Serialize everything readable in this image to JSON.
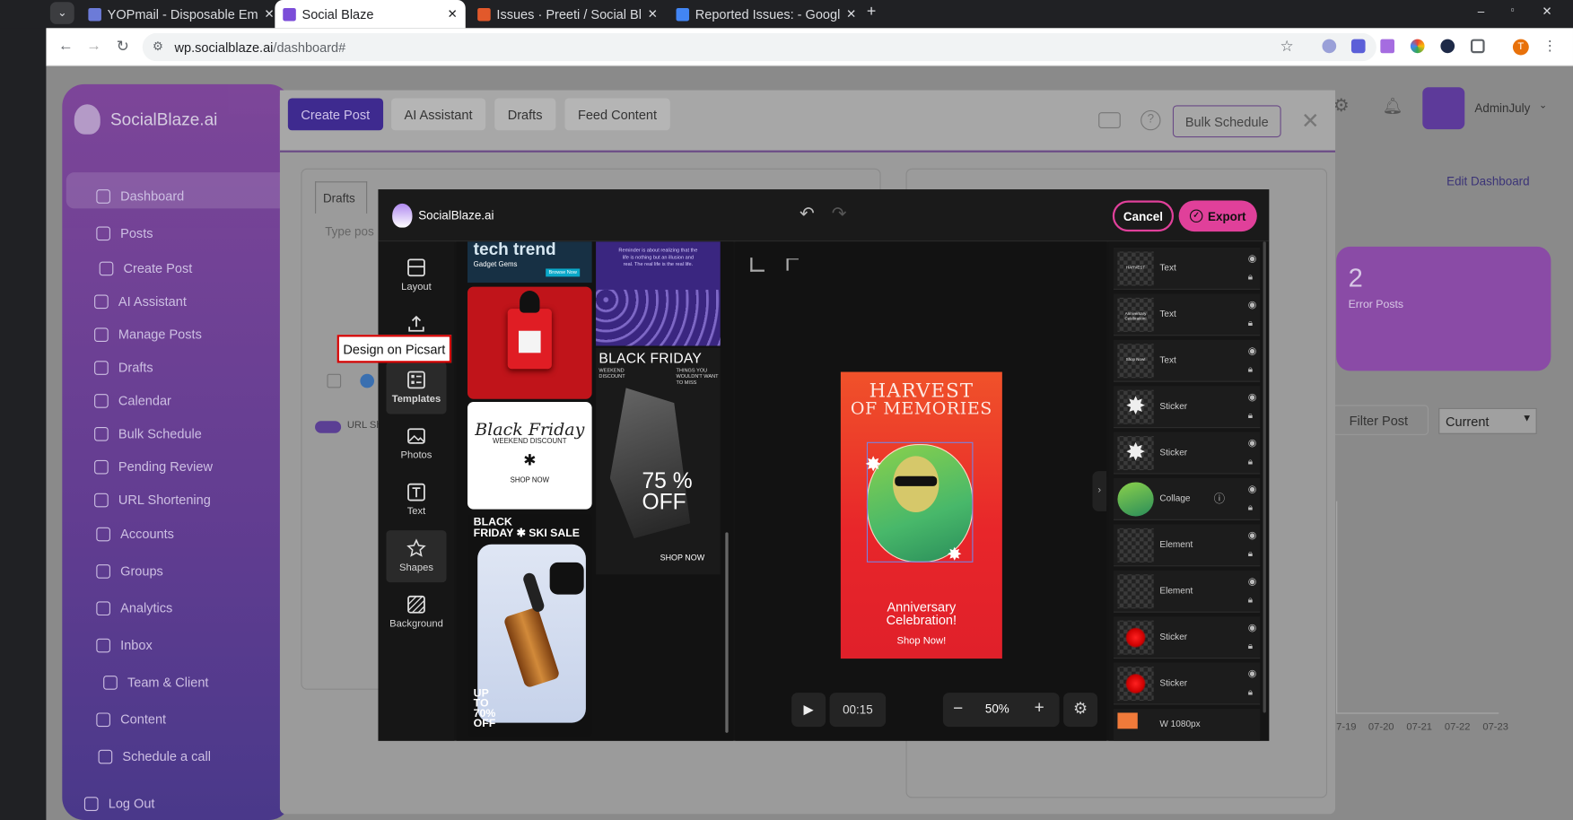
{
  "browser": {
    "tabs": [
      {
        "label": "YOPmail - Disposable Em",
        "color": "#6c7bd8"
      },
      {
        "label": "Social Blaze",
        "color": "#7b4dd8"
      },
      {
        "label": "Issues · Preeti / Social Bl",
        "color": "#e2592b"
      },
      {
        "label": "Reported Issues: - Googl",
        "color": "#4285f4"
      }
    ],
    "url_host": "wp.socialblaze.ai",
    "url_path": "/dashboard#",
    "profile_initial": "T"
  },
  "app": {
    "logo": "SocialBlaze.ai",
    "user": "AdminJuly",
    "sidebar": [
      "Dashboard",
      "Posts",
      "Create Post",
      "AI Assistant",
      "Manage Posts",
      "Drafts",
      "Calendar",
      "Bulk Schedule",
      "Pending Review",
      "URL Shortening",
      "Accounts",
      "Groups",
      "Analytics",
      "Inbox",
      "Team & Client",
      "Content",
      "Schedule a call",
      "Log Out"
    ],
    "edit_dashboard": "Edit Dashboard",
    "error_count": "2",
    "error_label": "Error Posts",
    "filter_post": "Filter Post",
    "filter_select": "Current",
    "dates": [
      "7-19",
      "07-20",
      "07-21",
      "07-22",
      "07-23"
    ]
  },
  "create_post": {
    "tabs": [
      "Create Post",
      "AI Assistant",
      "Drafts",
      "Feed Content"
    ],
    "bulk_schedule": "Bulk Schedule",
    "drafts_tab": "Drafts",
    "placeholder": "Type pos",
    "url_toggle": "URL Sh"
  },
  "editor": {
    "logo": "SocialBlaze.ai",
    "cancel": "Cancel",
    "export": "Export",
    "tools": [
      "Layout",
      "",
      "Templates",
      "Photos",
      "Text",
      "Shapes",
      "Background"
    ],
    "tooltip": "Design on Picsart",
    "templates": {
      "tech_title": "tech trend",
      "tech_sub": "Gadget Gems",
      "tech_btn": "Browse Now",
      "quote": "Reminder is about realizing that the life is nothing but an illusion and real. The real life is the real life.",
      "bf_script": "Black Friday",
      "bf_sub": "WEEKEND DISCOUNT",
      "bf_shop": "SHOP NOW",
      "bf2_title": "BLACK FRIDAY",
      "bf2_sub": "WEEKEND DISCOUNT",
      "bf2_note": "THINGS YOU WOULDN'T WANT TO MISS",
      "bf2_pct": "75 %",
      "bf2_off": "OFF",
      "bf2_shop": "SHOP NOW",
      "ski_l1": "BLACK",
      "ski_l2": "FRIDAY  ✱  SKI SALE",
      "ski_up": "UP",
      "ski_to": "TO",
      "ski_pct": "70%",
      "ski_off": "OFF"
    },
    "canvas": {
      "title1": "HARVEST",
      "title2": "OF MEMORIES",
      "sub1": "Anniversary",
      "sub2": "Celebration!",
      "cta": "Shop Now!"
    },
    "time": "00:15",
    "zoom": "50%",
    "layers": [
      {
        "name": "Text",
        "thumb": "HARVEST"
      },
      {
        "name": "Text",
        "thumb": "Anniversary Celebration!"
      },
      {
        "name": "Text",
        "thumb": "Shop Now!"
      },
      {
        "name": "Sticker",
        "thumb": ""
      },
      {
        "name": "Sticker",
        "thumb": ""
      },
      {
        "name": "Collage",
        "thumb": ""
      },
      {
        "name": "Element",
        "thumb": ""
      },
      {
        "name": "Element",
        "thumb": ""
      },
      {
        "name": "Sticker",
        "thumb": ""
      },
      {
        "name": "Sticker",
        "thumb": ""
      },
      {
        "name": "W  1080px",
        "thumb": ""
      }
    ]
  }
}
